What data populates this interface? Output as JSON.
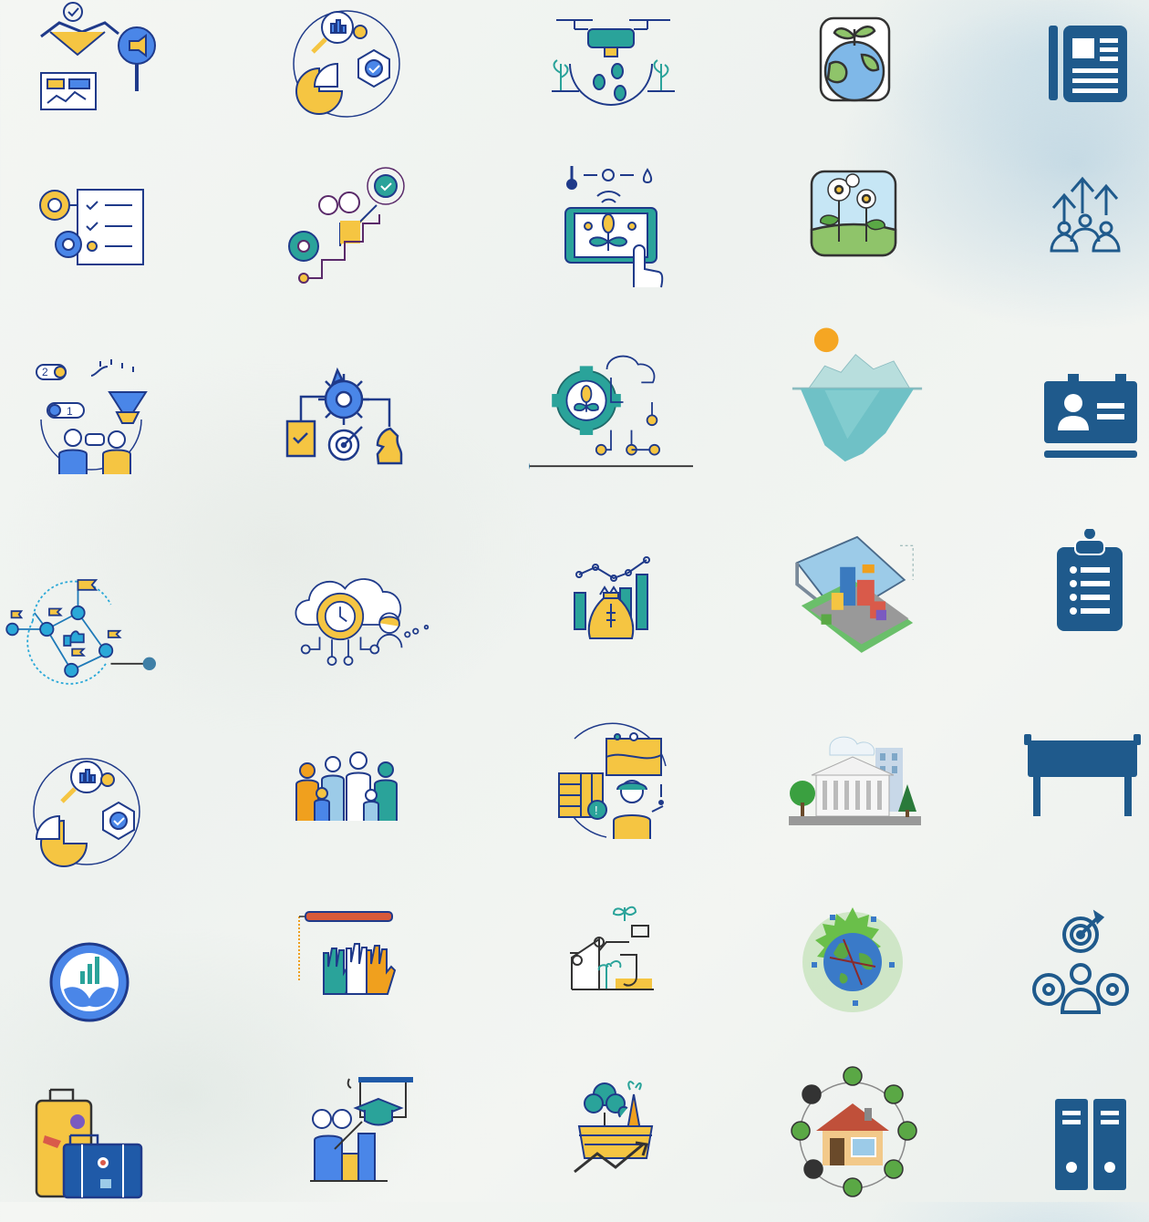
{
  "colors": {
    "ink": "#1f3a8a",
    "blue": "#4a86e8",
    "yellow": "#f5c542",
    "teal": "#2aa39a",
    "navy": "#1f5a8c",
    "orange": "#f0a01e",
    "green": "#5aa845"
  },
  "rows": [
    [
      "business-handshake-icon",
      "data-analysis-icon",
      "smart-farming-drone-icon",
      "earth-plant-icon",
      "newsletter-icon"
    ],
    [
      "process-checklist-icon",
      "career-growth-icon",
      "smart-agriculture-tablet-icon",
      "flowers-field-icon",
      "group-growth-icon"
    ],
    [
      "customer-journey-funnel-icon",
      "strategy-planning-icon",
      "agri-tech-cloud-gear-icon",
      "iceberg-icon",
      "id-card-icon"
    ],
    [
      "network-milestones-icon",
      "cloud-time-management-icon",
      "financial-growth-icon",
      "smart-city-icon",
      "clipboard-list-icon"
    ],
    [
      "data-analysis-icon-2",
      "family-generations-icon",
      "farm-risk-management-icon",
      "government-building-icon",
      "signboard-icon"
    ],
    [
      "sustainable-growth-icon",
      "raised-hands-vote-icon",
      "robotic-agriculture-icon",
      "green-earth-icon",
      "team-goals-icon"
    ],
    [
      "travel-luggage-icon",
      "education-growth-icon",
      "agri-produce-growth-icon",
      "eco-home-icon",
      "binders-icon"
    ]
  ]
}
